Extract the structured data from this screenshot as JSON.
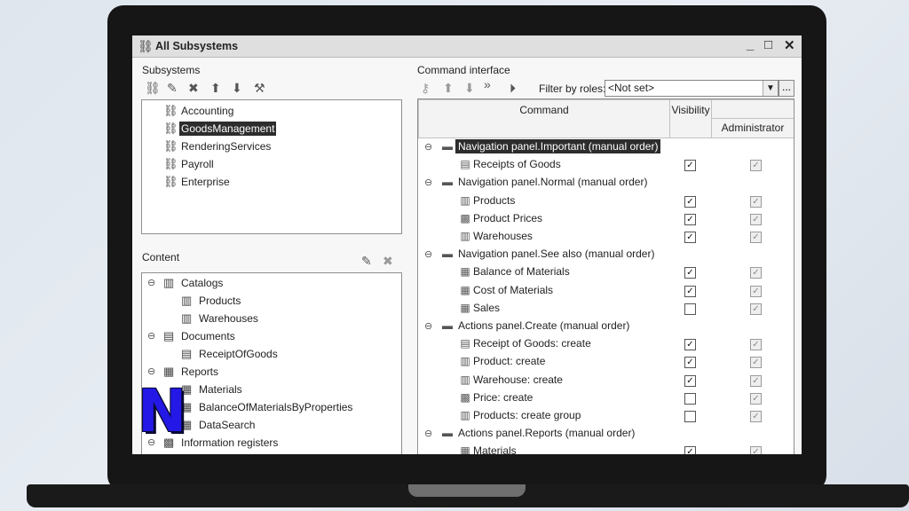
{
  "window": {
    "title": "All Subsystems",
    "minimize": "_",
    "maximize": "□",
    "close": "✕"
  },
  "subsystems": {
    "label": "Subsystems",
    "items": [
      {
        "label": "Accounting",
        "selected": false
      },
      {
        "label": "GoodsManagement",
        "selected": true
      },
      {
        "label": "RenderingServices",
        "selected": false
      },
      {
        "label": "Payroll",
        "selected": false
      },
      {
        "label": "Enterprise",
        "selected": false
      }
    ]
  },
  "content": {
    "label": "Content",
    "rows": [
      {
        "label": "Catalogs",
        "toggle": "⊖",
        "icon": "catalog-icon"
      },
      {
        "label": "Products",
        "icon": "catalog-icon"
      },
      {
        "label": "Warehouses",
        "icon": "catalog-icon"
      },
      {
        "label": "Documents",
        "toggle": "⊖",
        "icon": "document-icon"
      },
      {
        "label": "ReceiptOfGoods",
        "icon": "document-icon"
      },
      {
        "label": "Reports",
        "toggle": "⊖",
        "icon": "report-icon"
      },
      {
        "label": "Materials",
        "icon": "report-icon"
      },
      {
        "label": "BalanceOfMaterialsByProperties",
        "icon": "report-icon"
      },
      {
        "label": "DataSearch",
        "icon": "report-icon"
      },
      {
        "label": "Information registers",
        "toggle": "⊖",
        "icon": "register-icon"
      }
    ]
  },
  "command_interface": {
    "label": "Command interface",
    "filter_label": "Filter by roles:",
    "filter_value": "<Not set>",
    "filter_more": "...",
    "headers": {
      "command": "Command",
      "visibility": "Visibility",
      "administrator": "Administrator"
    },
    "rows": [
      {
        "type": "group",
        "label": "Navigation panel.Important (manual order)",
        "highlight": true
      },
      {
        "type": "item",
        "label": "Receipts of Goods",
        "icon": "document-icon",
        "visibility": true,
        "admin": true
      },
      {
        "type": "group",
        "label": "Navigation panel.Normal (manual order)"
      },
      {
        "type": "item",
        "label": "Products",
        "icon": "catalog-icon",
        "visibility": true,
        "admin": true
      },
      {
        "type": "item",
        "label": "Product Prices",
        "icon": "register-icon",
        "visibility": true,
        "admin": true
      },
      {
        "type": "item",
        "label": "Warehouses",
        "icon": "catalog-icon",
        "visibility": true,
        "admin": true
      },
      {
        "type": "group",
        "label": "Navigation panel.See also (manual order)"
      },
      {
        "type": "item",
        "label": "Balance of Materials",
        "icon": "report-icon",
        "visibility": true,
        "admin": true
      },
      {
        "type": "item",
        "label": "Cost of Materials",
        "icon": "report-icon",
        "visibility": true,
        "admin": true
      },
      {
        "type": "item",
        "label": "Sales",
        "icon": "report-icon",
        "visibility": false,
        "admin": true
      },
      {
        "type": "group",
        "label": "Actions panel.Create (manual order)"
      },
      {
        "type": "item",
        "label": "Receipt of Goods: create",
        "icon": "document-icon",
        "visibility": true,
        "admin": true
      },
      {
        "type": "item",
        "label": "Product: create",
        "icon": "catalog-icon",
        "visibility": true,
        "admin": true
      },
      {
        "type": "item",
        "label": "Warehouse: create",
        "icon": "catalog-icon",
        "visibility": true,
        "admin": true
      },
      {
        "type": "item",
        "label": "Price: create",
        "icon": "register-icon",
        "visibility": false,
        "admin": true
      },
      {
        "type": "item",
        "label": "Products: create group",
        "icon": "catalog-icon",
        "visibility": false,
        "admin": true
      },
      {
        "type": "group",
        "label": "Actions panel.Reports (manual order)"
      },
      {
        "type": "item",
        "label": "Materials",
        "icon": "report-icon",
        "visibility": true,
        "admin": true
      }
    ]
  },
  "logo": {
    "letter": "N"
  }
}
